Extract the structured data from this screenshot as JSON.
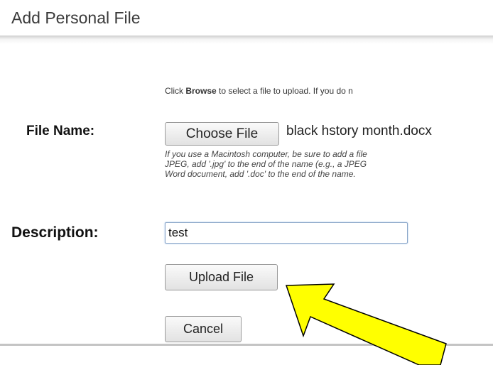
{
  "page": {
    "title": "Add Personal File"
  },
  "instructions": {
    "prefix": "Click ",
    "emphasis": "Browse",
    "suffix": " to select a file to upload. If you do n"
  },
  "file_name": {
    "label": "File Name:",
    "choose_button_label": "Choose File",
    "selected_file": "black hstory month.docx",
    "hint_lines": [
      "If you use a Macintosh computer, be sure to add a file",
      "JPEG, add '.jpg' to the end of the name (e.g., a JPEG",
      "Word document, add '.doc' to the end of the name."
    ]
  },
  "description": {
    "label": "Description:",
    "value": "test"
  },
  "actions": {
    "upload_label": "Upload File",
    "cancel_label": "Cancel"
  },
  "annotation": {
    "arrow_color": "#ffff00",
    "arrow_outline": "#000000"
  }
}
